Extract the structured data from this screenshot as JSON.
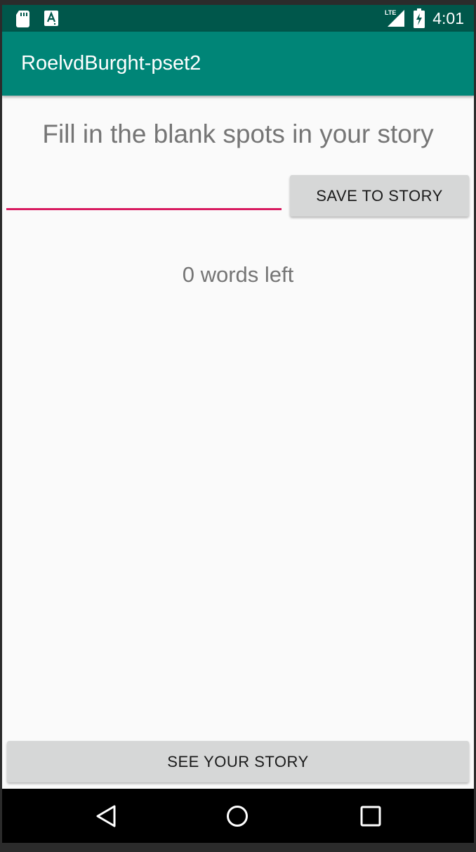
{
  "status_bar": {
    "time": "4:01",
    "network_label": "LTE",
    "icons": [
      "sd-card-icon",
      "font-a-icon",
      "lte-signal-icon",
      "battery-charging-icon"
    ],
    "background": "#00574b"
  },
  "app_bar": {
    "title": "RoelvdBurght-pset2",
    "background": "#008577"
  },
  "content": {
    "instruction": "Fill in the blank spots in your story",
    "input_value": "",
    "input_underline_color": "#d81b60",
    "save_button_label": "SAVE TO STORY",
    "words_left": "0 words left",
    "see_story_button_label": "SEE YOUR STORY"
  },
  "nav_bar": {
    "icons": [
      "back-icon",
      "home-icon",
      "recents-icon"
    ]
  }
}
